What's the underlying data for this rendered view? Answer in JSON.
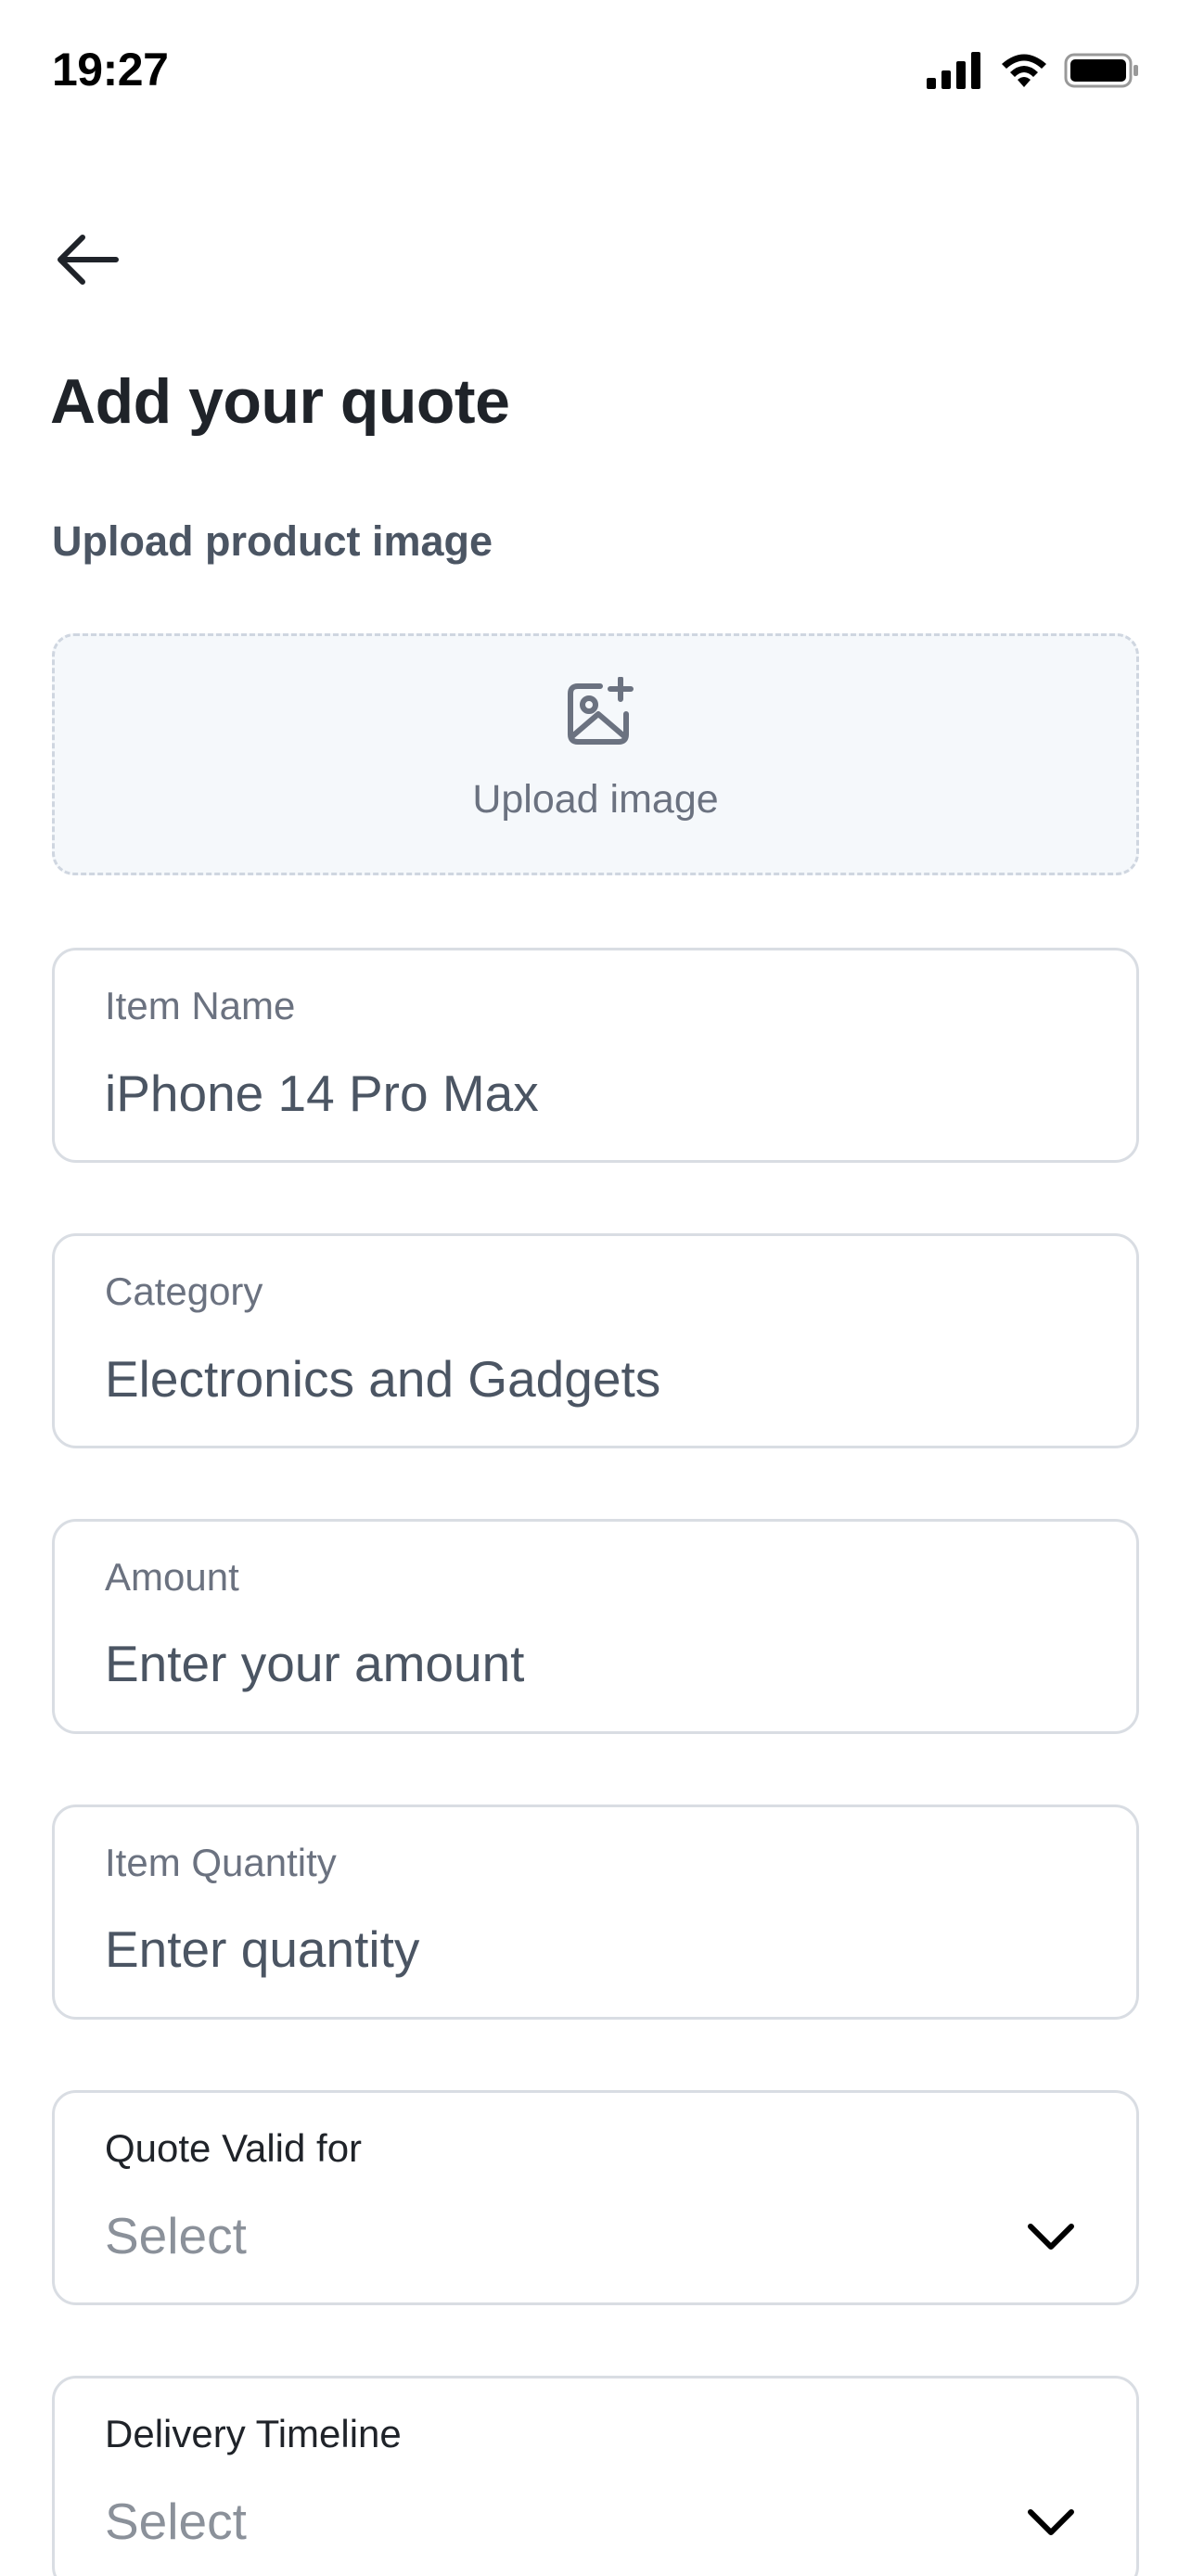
{
  "status_bar": {
    "time": "19:27"
  },
  "header": {
    "back_icon": "arrow-left-icon",
    "title": "Add your quote"
  },
  "upload": {
    "section_label": "Upload product image",
    "button_label": "Upload image",
    "icon": "image-plus-icon"
  },
  "fields": {
    "item_name": {
      "label": "Item Name",
      "value": "iPhone 14 Pro Max"
    },
    "category": {
      "label": "Category",
      "value": "Electronics and Gadgets"
    },
    "amount": {
      "label": "Amount",
      "placeholder": "Enter your amount"
    },
    "quantity": {
      "label": "Item Quantity",
      "placeholder": "Enter quantity"
    },
    "quote_valid": {
      "label": "Quote Valid for",
      "value": "Select",
      "icon": "chevron-down-icon"
    },
    "delivery": {
      "label": "Delivery Timeline",
      "value": "Select",
      "icon": "chevron-down-icon"
    }
  },
  "colors": {
    "title": "#1f2329",
    "muted": "#6b7280",
    "border": "#d9dde3",
    "upload_bg": "#f5f8fb",
    "upload_border": "#cfd6e0"
  }
}
